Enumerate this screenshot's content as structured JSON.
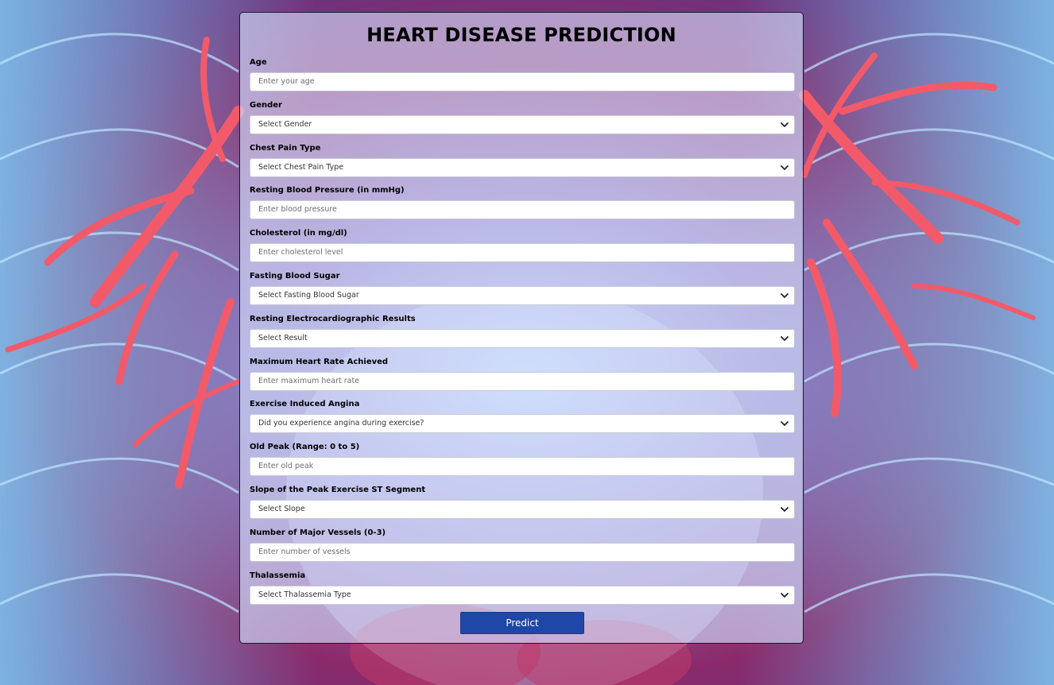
{
  "form": {
    "title": "HEART DISEASE PREDICTION",
    "fields": [
      {
        "label": "Age",
        "type": "input",
        "placeholder": "Enter your age"
      },
      {
        "label": "Gender",
        "type": "select",
        "selected": "Select Gender"
      },
      {
        "label": "Chest Pain Type",
        "type": "select",
        "selected": "Select Chest Pain Type"
      },
      {
        "label": "Resting Blood Pressure (in mmHg)",
        "type": "input",
        "placeholder": "Enter blood pressure"
      },
      {
        "label": "Cholesterol (in mg/dl)",
        "type": "input",
        "placeholder": "Enter cholesterol level"
      },
      {
        "label": "Fasting Blood Sugar",
        "type": "select",
        "selected": "Select Fasting Blood Sugar"
      },
      {
        "label": "Resting Electrocardiographic Results",
        "type": "select",
        "selected": "Select Result"
      },
      {
        "label": "Maximum Heart Rate Achieved",
        "type": "input",
        "placeholder": "Enter maximum heart rate"
      },
      {
        "label": "Exercise Induced Angina",
        "type": "select",
        "selected": "Did you experience angina during exercise?"
      },
      {
        "label": "Old Peak (Range: 0 to 5)",
        "type": "input",
        "placeholder": "Enter old peak"
      },
      {
        "label": "Slope of the Peak Exercise ST Segment",
        "type": "select",
        "selected": "Select Slope"
      },
      {
        "label": "Number of Major Vessels (0-3)",
        "type": "input",
        "placeholder": "Enter number of vessels"
      },
      {
        "label": "Thalassemia",
        "type": "select",
        "selected": "Select Thalassemia Type"
      }
    ],
    "submit_label": "Predict"
  },
  "theme": {
    "button_color": "#1f47a8",
    "background_blue": "#6fa6e0",
    "background_magenta": "#8a2a6a",
    "vessel_color": "#f25a6a"
  }
}
